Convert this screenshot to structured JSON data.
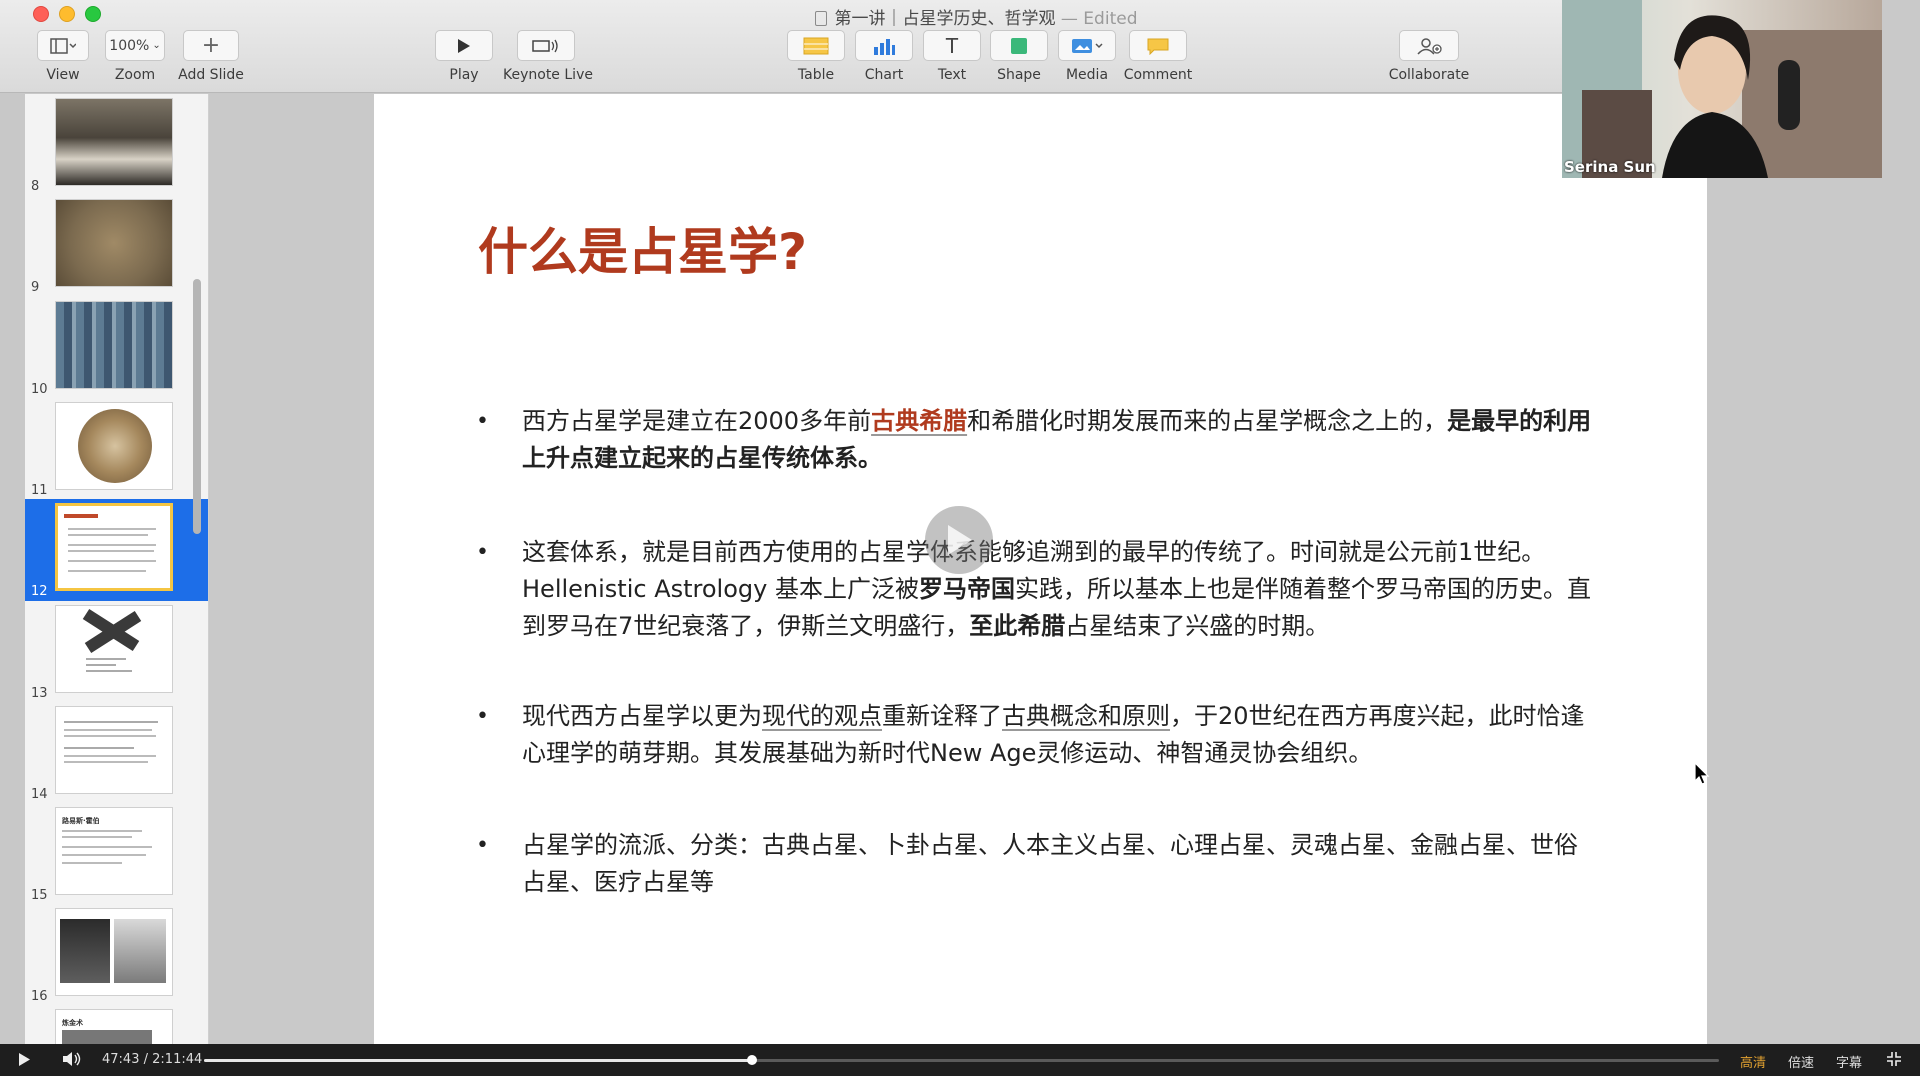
{
  "window": {
    "doc_title": "第一讲｜占星学历史、哲学观",
    "doc_status": "— Edited"
  },
  "toolbar": {
    "view_label": "View",
    "zoom_value": "100%",
    "zoom_label": "Zoom",
    "add_slide_label": "Add Slide",
    "play_label": "Play",
    "keynote_live_label": "Keynote Live",
    "table_label": "Table",
    "chart_label": "Chart",
    "text_label": "Text",
    "shape_label": "Shape",
    "media_label": "Media",
    "comment_label": "Comment",
    "collaborate_label": "Collaborate"
  },
  "sidebar": {
    "slides": [
      {
        "number": "8",
        "selected": false
      },
      {
        "number": "9",
        "selected": false
      },
      {
        "number": "10",
        "selected": false
      },
      {
        "number": "11",
        "selected": false
      },
      {
        "number": "12",
        "selected": true
      },
      {
        "number": "13",
        "selected": false
      },
      {
        "number": "14",
        "selected": false
      },
      {
        "number": "15",
        "selected": false
      },
      {
        "number": "16",
        "selected": false
      }
    ],
    "thumb_15_title": "路易斯·霍伯",
    "thumb_17_title": "炼金术"
  },
  "slide": {
    "title": "什么是占星学?",
    "bullets": [
      {
        "p1": "西方占星学是建立在2000多年前",
        "p2": "古典希腊",
        "p3": "和希腊化时期发展而来的占星学概念之上的，",
        "p4": "是最早的利用上升点建立起来的占星传统体系。"
      },
      {
        "p1": "这套体系，就是目前西方使用的占星学体系能够追溯到的最早的传统了。时间就是公元前1世纪。Hellenistic Astrology 基本上广泛被",
        "p2": "罗马帝国",
        "p3": "实践，所以基本上也是伴随着整个罗马帝国的历史。直到罗马在7世纪衰落了，伊斯兰文明盛行，",
        "p4": "至此希腊",
        "p5": "占星结束了兴盛的时期。"
      },
      {
        "p1": "现代西方占星学以更为",
        "p2": "现代的观点",
        "p3": "重新诠释了",
        "p4": "古典概念和原则",
        "p5": "，于20世纪在西方再度兴起，此时恰逢心理学的萌芽期。其发展基础为新时代New Age灵修运动、神智通灵协会组织。"
      },
      {
        "p1": "占星学的流派、分类：古典占星、卜卦占星、人本主义占星、心理占星、灵魂占星、金融占星、世俗占星、医疗占星等"
      }
    ]
  },
  "webcam": {
    "participant_name": "Serina Sun"
  },
  "video_player": {
    "current_time": "47:43",
    "separator": "/",
    "total_time": "2:11:44",
    "progress_fraction": 0.362,
    "quality_label": "高清",
    "speed_label": "倍速",
    "subtitle_label": "字幕"
  },
  "colors": {
    "title_red": "#b03a1e",
    "selection_blue": "#1d6ee8",
    "thumb_highlight": "#f5c542"
  }
}
